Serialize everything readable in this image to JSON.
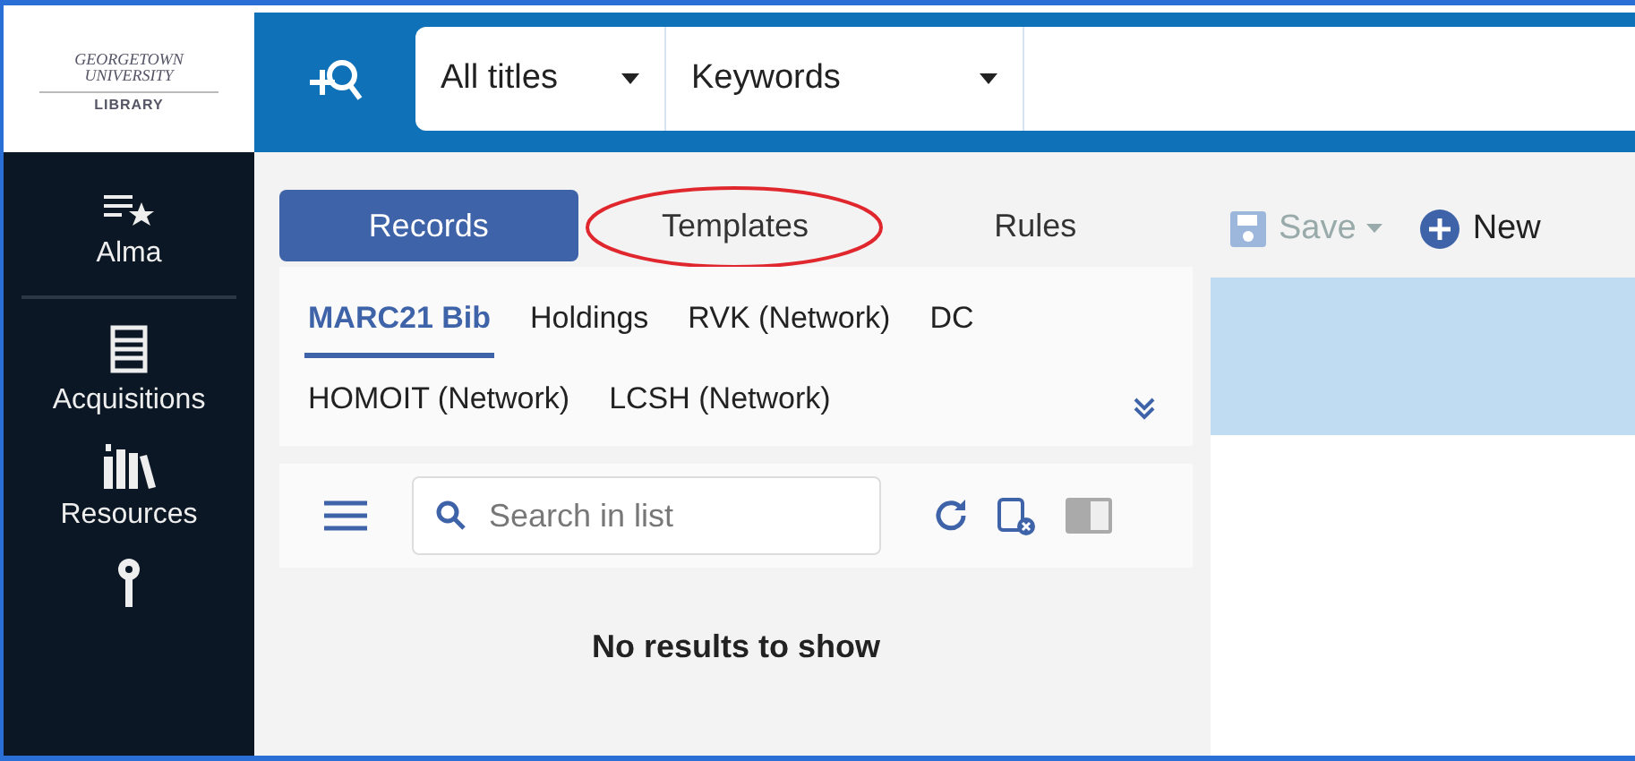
{
  "logo": {
    "lines": [
      "GEORGETOWN",
      "UNIVERSITY"
    ],
    "caption": "LIBRARY"
  },
  "search": {
    "scope": "All titles",
    "field": "Keywords"
  },
  "nav": [
    {
      "label": "Alma",
      "kind": "alma"
    },
    {
      "label": "Acquisitions",
      "kind": "acquisitions"
    },
    {
      "label": "Resources",
      "kind": "resources"
    },
    {
      "kind": "key"
    }
  ],
  "tabs": [
    {
      "label": "Records",
      "selected": true,
      "circled": false
    },
    {
      "label": "Templates",
      "selected": false,
      "circled": true
    },
    {
      "label": "Rules",
      "selected": false,
      "circled": false
    }
  ],
  "formats": [
    {
      "label": "MARC21 Bib",
      "selected": true
    },
    {
      "label": "Holdings",
      "selected": false
    },
    {
      "label": "RVK (Network)",
      "selected": false
    },
    {
      "label": "DC",
      "selected": false
    },
    {
      "label": "HOMOIT (Network)",
      "selected": false
    },
    {
      "label": "LCSH (Network)",
      "selected": false
    }
  ],
  "list_search": {
    "placeholder": "Search in list"
  },
  "empty_message": "No results to show",
  "toolbar": [
    {
      "label": "Save",
      "kind": "save",
      "disabled": true
    },
    {
      "label": "New",
      "kind": "new",
      "disabled": false
    }
  ]
}
